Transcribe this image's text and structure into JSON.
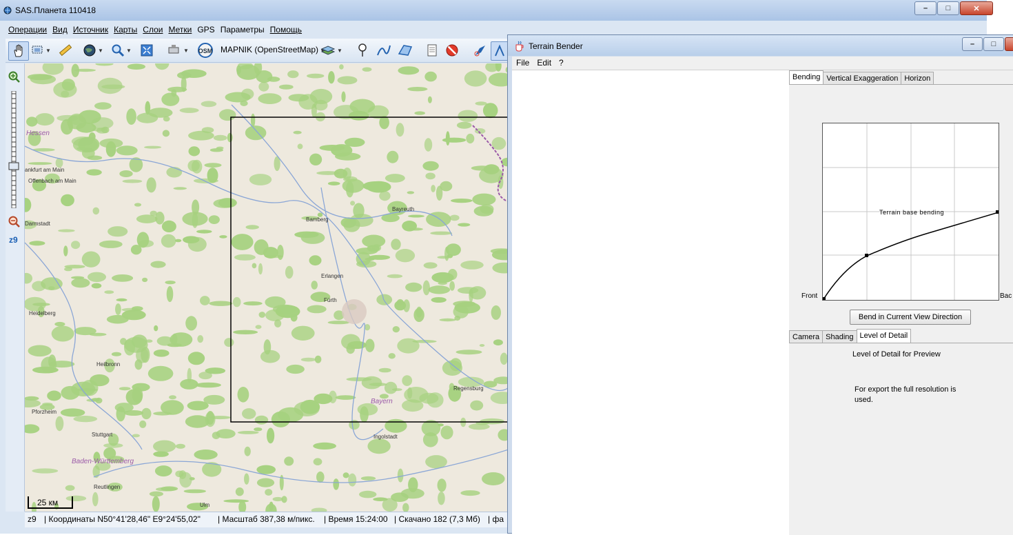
{
  "sas": {
    "title": "SAS.Планета 110418",
    "menu": [
      "Операции",
      "Вид",
      "Источник",
      "Карты",
      "Слои",
      "Метки",
      "GPS",
      "Параметры",
      "Помощь"
    ],
    "map_source": "MAPNIK (OpenStreetMap)",
    "osm_badge": "OSM",
    "zoom_level": "z9",
    "scale_label": "25 км",
    "cities": [
      "Hessen",
      "ankfurt am Main",
      "Offenbach am Main",
      "Darmstadt",
      "Heidelberg",
      "Heilbronn",
      "Pforzheim",
      "Stuttgart",
      "Reutlingen",
      "Ulm",
      "Bamberg",
      "Bayreuth",
      "Erlangen",
      "Fürth",
      "Regensburg",
      "Ingolstadt",
      "Bayern",
      "Baden-Württemberg"
    ],
    "status": {
      "zoom": "z9",
      "coords": "| Координаты N50°41'28,46\" E9°24'55,02\"",
      "scale": "| Масштаб 387,38 м/пикс.",
      "time": "| Время 15:24:00",
      "downloaded": "| Скачано 182 (7,3 Мб)",
      "tail": "| фа"
    },
    "colors": {
      "map_bg": "#eee9de",
      "forest": "#a6d17f",
      "river": "#8aa6d6",
      "border": "#9b5aa8"
    }
  },
  "tb": {
    "title": "Terrain Bender",
    "menu": [
      "File",
      "Edit",
      "?"
    ],
    "tabs_top": [
      "Bending",
      "Vertical Exaggeration",
      "Horizon"
    ],
    "graph_title": "Terrain base bending",
    "front_label": "Front",
    "back_label": "Bac",
    "bend_button": "Bend in Current View Direction",
    "tabs_bottom": [
      "Camera",
      "Shading",
      "Level of Detail"
    ],
    "lod_title": "Level of Detail for Preview",
    "lod_note": "For export the full resolution is used."
  }
}
